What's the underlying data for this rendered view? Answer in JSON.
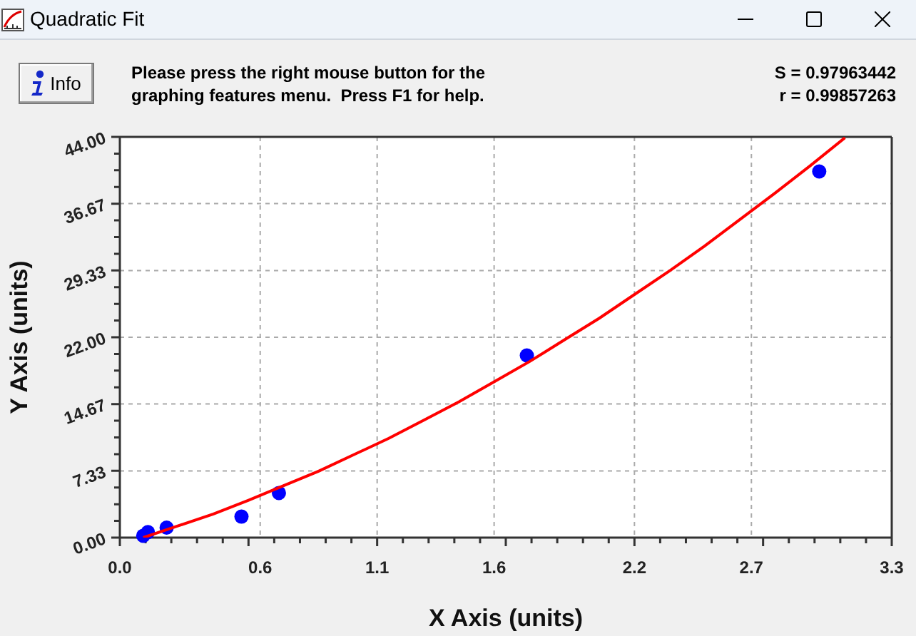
{
  "window": {
    "title": "Quadratic Fit"
  },
  "info_button": {
    "label": "Info"
  },
  "message": "Please press the right mouse button for the graphing features menu.  Press F1 for help.",
  "stats": [
    "S = 0.97963442",
    "r = 0.99857263"
  ],
  "chart_data": {
    "type": "scatter",
    "xlabel": "X Axis (units)",
    "ylabel": "Y Axis (units)",
    "xlim": [
      0,
      3.3
    ],
    "ylim": [
      0,
      44
    ],
    "xticks": [
      {
        "value": 0,
        "label": "0.0"
      },
      {
        "value": 0.6,
        "label": "0.6"
      },
      {
        "value": 1.1,
        "label": "1.1"
      },
      {
        "value": 1.6,
        "label": "1.6"
      },
      {
        "value": 2.2,
        "label": "2.2"
      },
      {
        "value": 2.7,
        "label": "2.7"
      },
      {
        "value": 3.3,
        "label": "3.3"
      }
    ],
    "yticks": [
      {
        "value": 0,
        "label": "0.00"
      },
      {
        "value": 7.33,
        "label": "7.33"
      },
      {
        "value": 14.67,
        "label": "14.67"
      },
      {
        "value": 22,
        "label": "22.00"
      },
      {
        "value": 29.33,
        "label": "29.33"
      },
      {
        "value": 36.67,
        "label": "36.67"
      },
      {
        "value": 44,
        "label": "44.00"
      }
    ],
    "grid": true,
    "series": [
      {
        "type": "scatter",
        "color": "#0000ff",
        "x": [
          0.1,
          0.12,
          0.2,
          0.52,
          0.68,
          1.74,
          2.99
        ],
        "values": [
          0.2,
          0.6,
          1.1,
          2.3,
          4.9,
          20.0,
          40.2
        ]
      },
      {
        "type": "line",
        "color": "#ff0000",
        "x": [
          0.1,
          0.25,
          0.4,
          0.55,
          0.7,
          0.85,
          1.0,
          1.15,
          1.3,
          1.45,
          1.6,
          1.75,
          1.9,
          2.05,
          2.2,
          2.35,
          2.5,
          2.65,
          2.8,
          2.95,
          3.1
        ],
        "values": [
          0.0,
          1.3,
          2.6,
          4.1,
          5.7,
          7.3,
          9.1,
          10.9,
          12.9,
          14.9,
          17.1,
          19.3,
          21.7,
          24.1,
          26.7,
          29.3,
          32.0,
          34.9,
          37.8,
          40.8,
          43.9
        ]
      }
    ]
  }
}
